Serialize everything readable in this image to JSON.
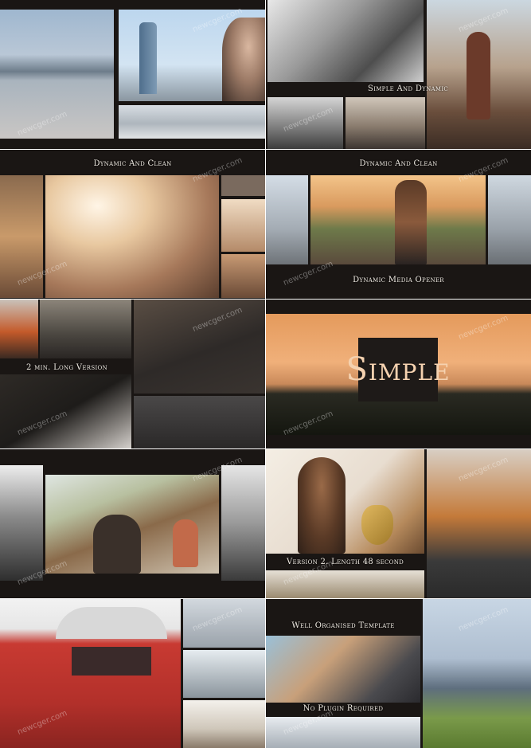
{
  "watermark": "newcger.com",
  "captions": {
    "tile2": "Simple And Dynamic",
    "tile3": "Dynamic And Clean",
    "tile4_top": "Dynamic And Clean",
    "tile4_bottom": "Dynamic Media Opener",
    "tile5": "2 min. Long Version",
    "tile6_title": "Simple",
    "tile8": "Version 2. Length 48 second",
    "tile10_top": "Well Organised Template",
    "tile10_bottom": "No Plugin Required"
  },
  "colors": {
    "frame_dark": "#1a1614",
    "caption_text": "#f1ece4",
    "sunset_orange": "#d98a55",
    "title_box": "#1e1a18"
  }
}
